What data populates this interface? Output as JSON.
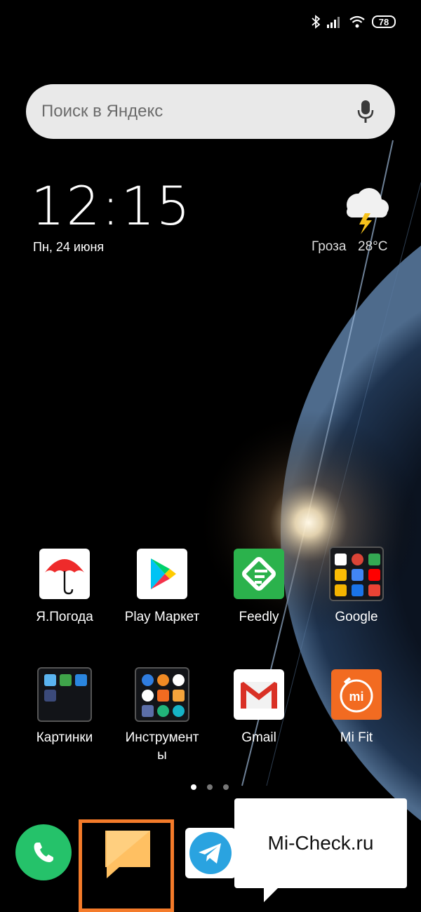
{
  "status_bar": {
    "battery": "78",
    "icons": [
      "bluetooth-icon",
      "signal-icon",
      "wifi-icon",
      "battery-icon"
    ]
  },
  "search": {
    "placeholder": "Поиск в Яндекс",
    "icon": "mic-icon"
  },
  "clock": {
    "time": "12:15",
    "date": "Пн, 24 июня"
  },
  "weather": {
    "condition": "Гроза",
    "temperature": "28°C",
    "icon": "thunderstorm-icon"
  },
  "apps_row1": [
    {
      "label": "Я.Погода",
      "icon": "umbrella-icon"
    },
    {
      "label": "Play Маркет",
      "icon": "play-store-icon"
    },
    {
      "label": "Feedly",
      "icon": "feedly-icon"
    },
    {
      "label": "Google",
      "icon": "folder-icon"
    }
  ],
  "apps_row2": [
    {
      "label": "Картинки",
      "icon": "folder-icon"
    },
    {
      "label": "Инструмент\nы",
      "icon": "folder-icon"
    },
    {
      "label": "Gmail",
      "icon": "gmail-icon"
    },
    {
      "label": "Mi Fit",
      "icon": "mi-fit-icon"
    }
  ],
  "page_indicator": {
    "pages": 3,
    "current": 1
  },
  "dock": [
    "phone-icon",
    "messages-icon",
    "telegram-icon"
  ],
  "callout": {
    "text": "Mi-Check.ru"
  },
  "colors": {
    "highlight": "#f47b2a",
    "phone": "#25c26a",
    "messages": "#ffc062",
    "feedly": "#2bb24c",
    "mi_fit": "#f26b21",
    "telegram": "#2aa3e0"
  }
}
